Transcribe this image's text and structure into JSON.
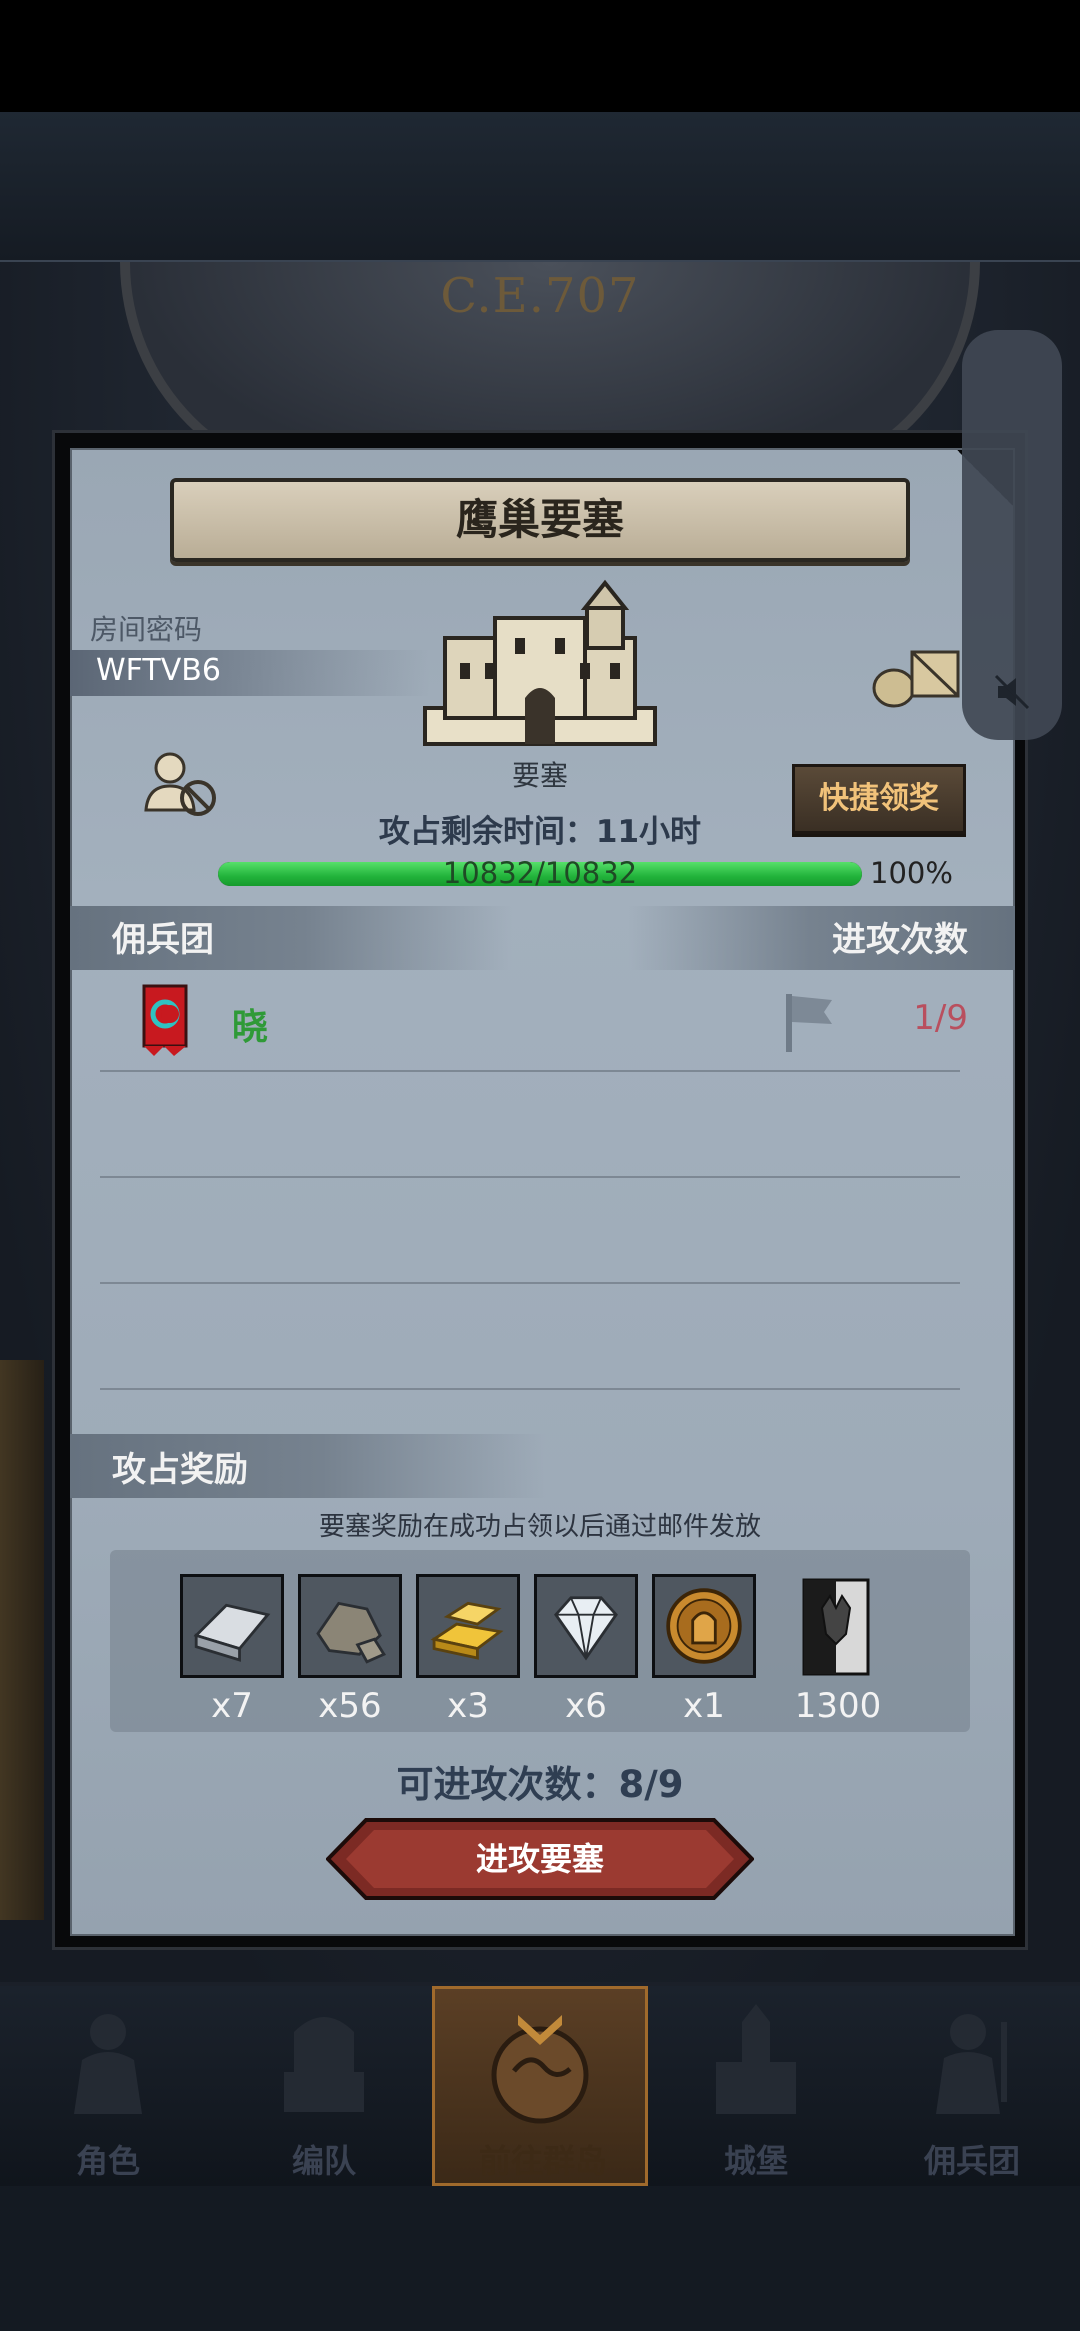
{
  "header": {
    "era_text": "C.E.707"
  },
  "dialog": {
    "title": "鹰巢要塞",
    "room": {
      "label": "房间密码",
      "code": "WFTVB6"
    },
    "fortress": {
      "label": "要塞"
    },
    "quick_claim_label": "快捷领奖",
    "time_remaining": "攻占剩余时间：11小时",
    "hp": {
      "text": "10832/10832",
      "percent_text": "100%",
      "fraction": 1.0
    },
    "mercenary_section": {
      "title": "佣兵团",
      "attacks_header": "进攻次数",
      "rows": [
        {
          "name": "晓",
          "count": "1/9"
        }
      ]
    },
    "rewards_section": {
      "title": "攻占奖励",
      "note": "要塞奖励在成功占领以后通过邮件发放",
      "items": [
        {
          "icon": "silver-ingot-icon",
          "qty": "x7"
        },
        {
          "icon": "ore-stone-icon",
          "qty": "x56"
        },
        {
          "icon": "gold-bars-icon",
          "qty": "x3"
        },
        {
          "icon": "diamond-icon",
          "qty": "x6"
        },
        {
          "icon": "knight-coin-icon",
          "qty": "x1"
        },
        {
          "icon": "demon-banner-icon",
          "qty": "1300"
        }
      ]
    },
    "attack_count": "可进攻次数：8/9",
    "attack_button_label": "进攻要塞"
  },
  "bottom_nav": [
    {
      "label": "角色",
      "icon": "character-icon"
    },
    {
      "label": "编队",
      "icon": "formation-icon"
    },
    {
      "label": "前往群岛",
      "icon": "archipelago-icon",
      "active": true
    },
    {
      "label": "城堡",
      "icon": "castle-icon"
    },
    {
      "label": "佣兵团",
      "icon": "mercenary-icon"
    }
  ],
  "colors": {
    "accent_gold": "#f1c27a",
    "hp_green": "#22b33b",
    "attack_count_red": "#b94f5e",
    "mercenary_name_green": "#2f9a37"
  }
}
